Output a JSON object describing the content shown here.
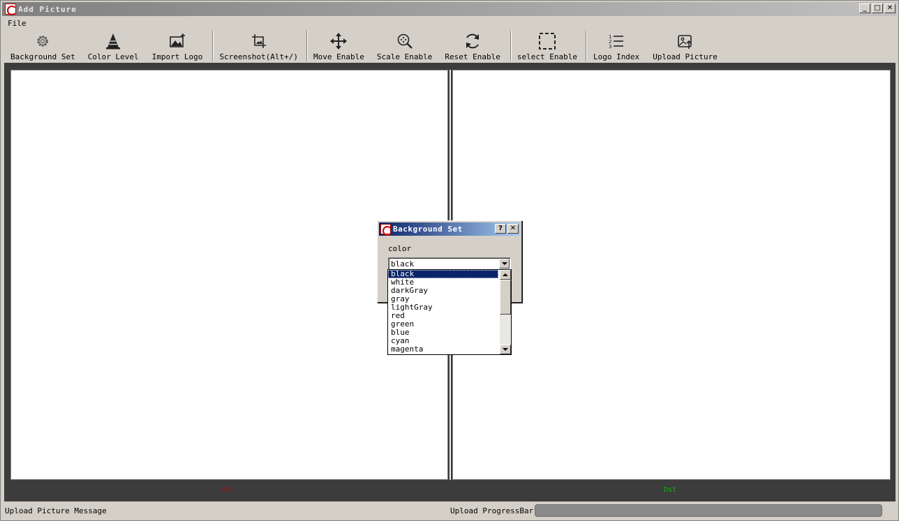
{
  "window": {
    "title": "Add Picture",
    "controls": [
      "_",
      "□",
      "✕"
    ]
  },
  "menu": {
    "file": "File"
  },
  "toolbar": {
    "background_set": "Background Set",
    "color_level": "Color Level",
    "import_logo": "Import Logo",
    "screenshot": "Screenshot(Alt+/)",
    "move_enable": "Move Enable",
    "scale_enable": "Scale Enable",
    "reset_enable": "Reset Enable",
    "select_enable": "select Enable",
    "logo_index": "Logo Index",
    "upload_picture": "Upload Picture"
  },
  "canvas": {
    "src_label": "Src",
    "dst_label": "Dst",
    "src_color": "#d00000",
    "dst_color": "#00c000"
  },
  "status": {
    "message": "Upload Picture Message",
    "progress_label": "Upload ProgressBar:",
    "progress": 0
  },
  "dialog": {
    "title": "Background Set",
    "help": "?",
    "close": "✕",
    "color_label": "color",
    "selected": "black",
    "options": [
      "black",
      "white",
      "darkGray",
      "gray",
      "lightGray",
      "red",
      "green",
      "blue",
      "cyan",
      "magenta"
    ]
  }
}
